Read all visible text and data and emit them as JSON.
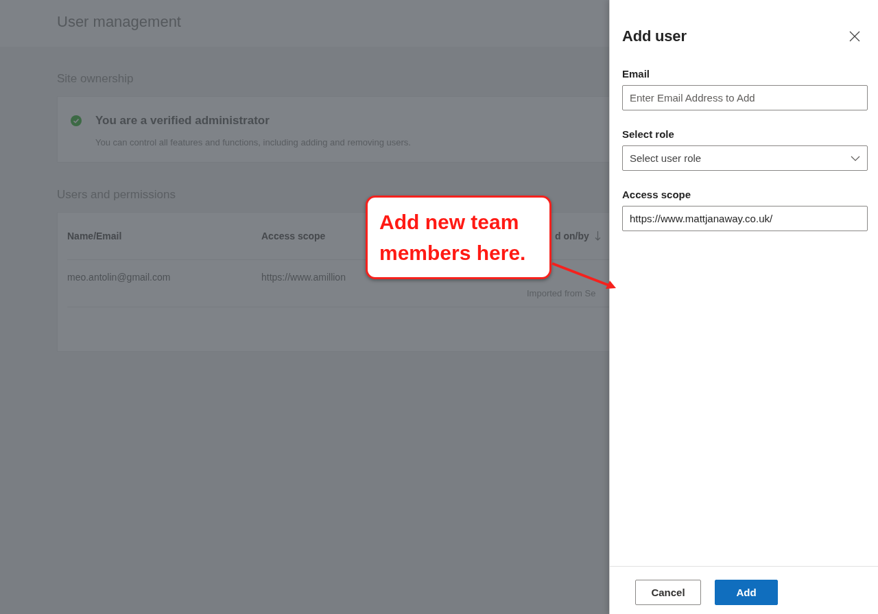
{
  "background_page": {
    "title": "User management",
    "site_ownership": {
      "heading": "Site ownership",
      "status_title": "You are a verified administrator",
      "status_text": "You can control all features and functions, including adding and removing users."
    },
    "users_and_permissions": {
      "heading": "Users and permissions",
      "table": {
        "columns": [
          "Name/Email",
          "Access scope",
          "d on/by"
        ],
        "rows": [
          [
            "meo.antolin@gmail.com",
            "https://www.amillion",
            "Imported from Se"
          ]
        ]
      }
    }
  },
  "panel": {
    "title": "Add user",
    "fields": [
      {
        "kind": "text",
        "label": "Email",
        "placeholder": "Enter Email Address to Add"
      },
      {
        "kind": "dropdown",
        "label": "Select role",
        "placeholder": "Select user role"
      },
      {
        "kind": "text",
        "label": "Access scope",
        "value": "https://www.mattjanaway.co.uk/"
      }
    ],
    "buttons": [
      {
        "kind": "secondary",
        "label": "Cancel"
      },
      {
        "kind": "primary",
        "label": "Add"
      }
    ]
  },
  "callout": {
    "text": "Add new team members here."
  }
}
